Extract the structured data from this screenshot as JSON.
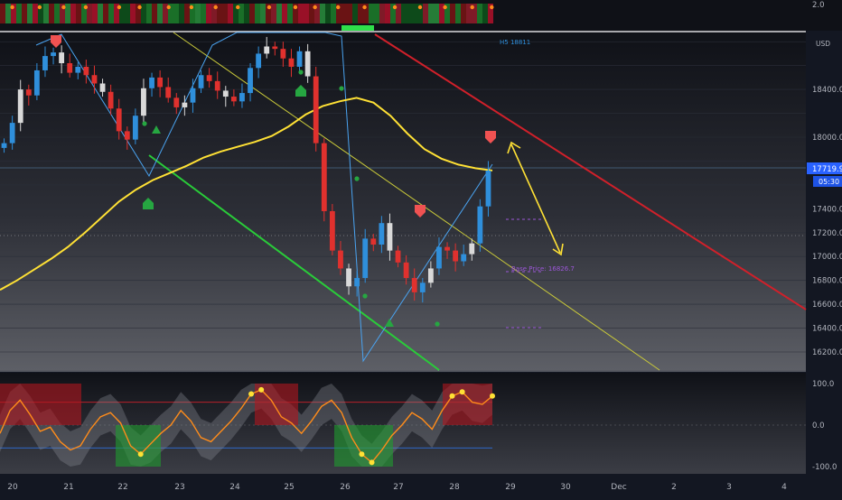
{
  "chart_data": {
    "type": "candlestick",
    "panels": [
      "top-indicator",
      "price",
      "oscillator"
    ],
    "price_axis": {
      "currency": "USD",
      "ticks": [
        16200,
        16400,
        16600,
        16800,
        17000,
        17200,
        17400,
        17600,
        17800,
        18000,
        18200,
        18400,
        18600,
        18800
      ],
      "tick_labels": [
        "16200.0",
        "16400.0",
        "16600.0",
        "16800.0",
        "17000.0",
        "17200.0",
        "17400.0",
        "",
        "",
        "18000.0",
        "",
        "18400.0",
        "",
        ""
      ],
      "ylim": [
        16100,
        18900
      ],
      "current_price": "17719.9",
      "countdown": "05:30"
    },
    "top_axis_label": "2.0",
    "oscillator_axis": {
      "ticks": [
        100,
        0,
        -100
      ],
      "tick_labels": [
        "100.0",
        "0.0",
        "-100.0"
      ],
      "ylim": [
        -120,
        120
      ]
    },
    "x_axis": {
      "labels": [
        "20",
        "21",
        "22",
        "23",
        "24",
        "25",
        "26",
        "27",
        "28",
        "29",
        "30",
        "Dec",
        "2",
        "3",
        "4"
      ]
    },
    "price_series": [
      17950,
      18120,
      18400,
      18350,
      18560,
      18680,
      18710,
      18620,
      18540,
      18590,
      18520,
      18450,
      18380,
      18240,
      18050,
      17980,
      18180,
      18410,
      18500,
      18420,
      18330,
      18250,
      18290,
      18410,
      18520,
      18470,
      18390,
      18340,
      18300,
      18370,
      18580,
      18700,
      18760,
      18740,
      18660,
      18590,
      18720,
      18510,
      17950,
      17380,
      17050,
      16900,
      16750,
      16820,
      17150,
      17100,
      17280,
      17050,
      16950,
      16820,
      16700,
      16780,
      16900,
      17080,
      17050,
      16960,
      17020,
      17110,
      17420,
      17719.9
    ],
    "moving_average": [
      16720,
      16800,
      16890,
      16980,
      17080,
      17200,
      17330,
      17460,
      17560,
      17640,
      17700,
      17760,
      17830,
      17880,
      17920,
      17960,
      18010,
      18090,
      18190,
      18260,
      18300,
      18330,
      18290,
      18180,
      18030,
      17900,
      17820,
      17770,
      17740,
      17720
    ],
    "annotations": [
      {
        "text": "H5 18811",
        "color": "#2f8fdb"
      },
      {
        "text": "Base Price: 16826.7",
        "color": "#9c57d8"
      }
    ],
    "oscillator_series": [
      -20,
      35,
      60,
      25,
      -15,
      -5,
      -40,
      -60,
      -50,
      -10,
      20,
      30,
      5,
      -50,
      -70,
      -45,
      -20,
      0,
      35,
      10,
      -30,
      -40,
      -15,
      10,
      40,
      75,
      85,
      60,
      20,
      5,
      -20,
      10,
      45,
      60,
      30,
      -30,
      -70,
      -90,
      -60,
      -25,
      0,
      30,
      15,
      -10,
      35,
      70,
      80,
      55,
      50,
      70
    ],
    "colors": {
      "background": "#131722",
      "bull": "#2f8fdb",
      "bear": "#e0312e",
      "neutral": "#d9d9d9",
      "moving_average": "#ffe135",
      "channel_top": "#d0202a",
      "channel_bottom": "#29cc39",
      "trendline": "#c9c93a",
      "current_price_tag": "#2962ff"
    }
  }
}
